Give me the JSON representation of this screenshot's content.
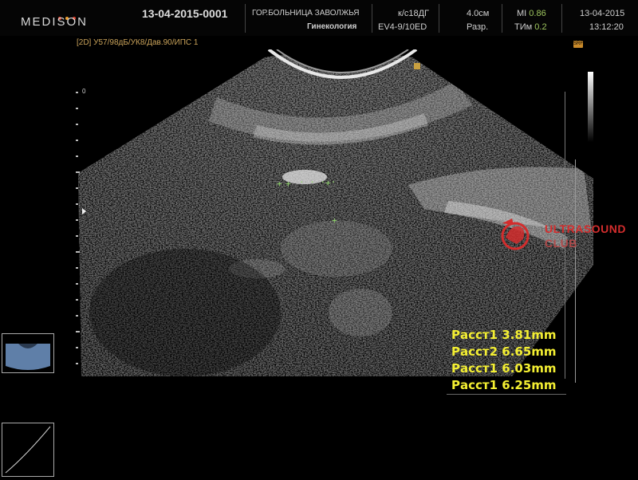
{
  "header": {
    "logo": "MEDISON",
    "study_id": "13-04-2015-0001",
    "hospital": "ГОР.БОЛЬНИЦА ЗАВОЛЖЬЯ",
    "department": "Гинекология",
    "study_type": "к/с18ДГ",
    "probe": "EV4-9/10ED",
    "depth": "4.0см",
    "mode": "Разр.",
    "mi_label": "MI",
    "mi_value": "0.86",
    "tim_label": "ТИм",
    "tim_value": "0.2",
    "date": "13-04-2015",
    "time": "13:12:20"
  },
  "params": {
    "mode_tag": "[2D]",
    "settings": "У57/98дБ/УК8/Дав.90/",
    "ips": "ИПС 1"
  },
  "scale": {
    "zero_label": "0"
  },
  "measurements": [
    {
      "label": "Расст1",
      "value": "3.81mm"
    },
    {
      "label": "Расст2",
      "value": "6.65mm"
    },
    {
      "label": "Расст1",
      "value": "6.03mm"
    },
    {
      "label": "Расст1",
      "value": "6.25mm"
    }
  ],
  "watermark": {
    "line1": "ULTRASOUND",
    "line2": "CLUB",
    "color_red": "#d32d2d"
  },
  "colors": {
    "measurement_yellow": "#f4ef32",
    "param_orange": "#caa35a",
    "mi_green": "#9fc65f"
  },
  "icons": {
    "orientation_marker": "orientation-marker-icon",
    "focus_marker": "focus-arrow-icon"
  }
}
